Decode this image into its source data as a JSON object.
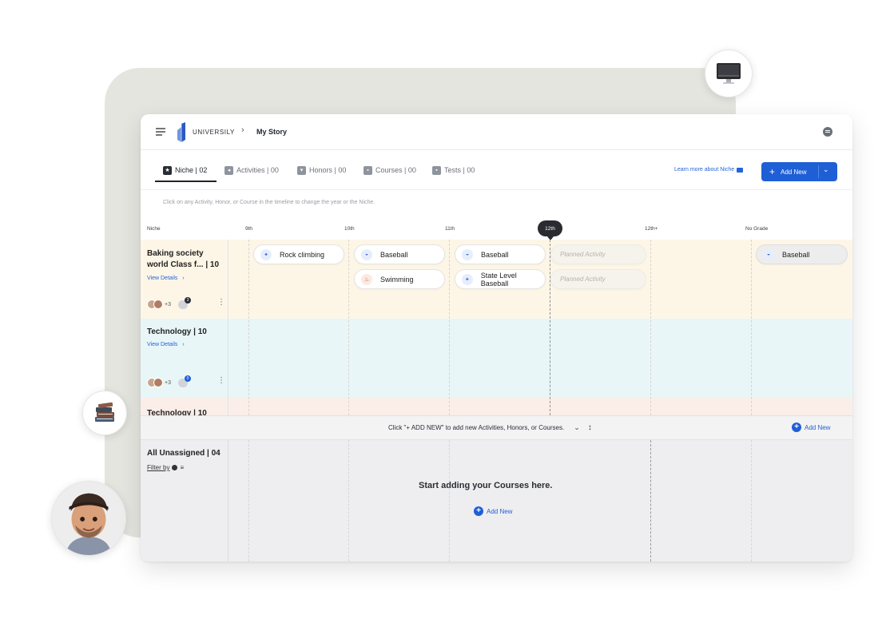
{
  "header": {
    "brand": "UNIVERSILY",
    "breadcrumb_sep": ">",
    "page_title": "My Story"
  },
  "tabs": [
    {
      "label": "Niche | 02",
      "icon": "star-icon",
      "active": true
    },
    {
      "label": "Activities | 00",
      "icon": "flag-icon",
      "active": false
    },
    {
      "label": "Honors | 00",
      "icon": "award-icon",
      "active": false
    },
    {
      "label": "Courses | 00",
      "icon": "book-icon",
      "active": false
    },
    {
      "label": "Tests | 00",
      "icon": "test-icon",
      "active": false
    }
  ],
  "learn_more": "Learn more about Niche",
  "add_new_button": "Add New",
  "hint": "Click on any Activity, Honor, or Course in the timeline to change the year or the Niche.",
  "grades": {
    "niche_col": "Niche",
    "g9": "9th",
    "g10": "10th",
    "g11": "11th",
    "g12": "12th",
    "g12plus": "12th+",
    "nograde": "No Grade"
  },
  "rows": [
    {
      "title_line1": "Baking society",
      "title_line2": "world Class f... | 10",
      "view_details": "View Details",
      "avatar_more": "+3",
      "comment_count": "3",
      "activities": {
        "g9_1": "Rock climbing",
        "g10_1": "Baseball",
        "g10_2": "Swimming",
        "g11_1": "Baseball",
        "g11_2": "State Level Baseball",
        "g12_1": "Planned Activity",
        "g12_2": "Planned Activity",
        "nograde_1": "Baseball"
      }
    },
    {
      "title": "Technology | 10",
      "view_details": "View Details",
      "avatar_more": "+3",
      "comment_count": "0"
    },
    {
      "title": "Technology | 10"
    }
  ],
  "divider": {
    "text": "Click \"+ ADD NEW\" to add new Activities, Honors, or Courses.",
    "add_new": "Add New"
  },
  "unassigned": {
    "title": "All Unassigned | 04",
    "filter": "Filter by",
    "empty_title": "Start adding your Courses here.",
    "add_new": "Add New"
  },
  "colors": {
    "accent": "#1f5fd6",
    "row1_bg": "#fdf6e7",
    "row2_bg": "#e8f6f8",
    "row3_bg": "#fbeee9"
  }
}
